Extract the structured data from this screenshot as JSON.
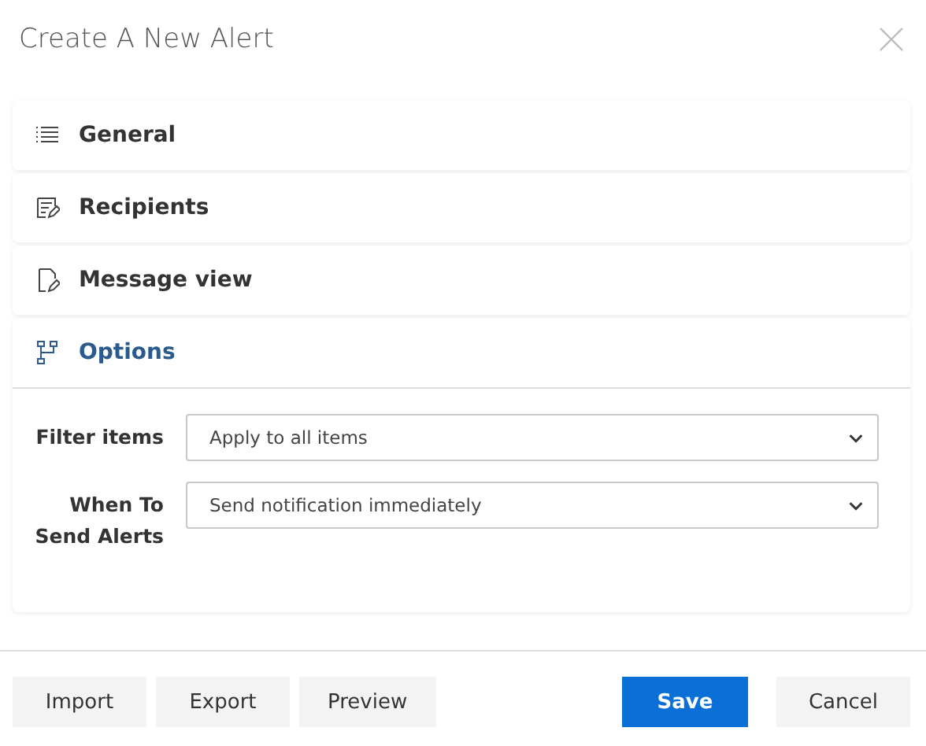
{
  "dialog": {
    "title": "Create A New Alert"
  },
  "sections": [
    {
      "label": "General",
      "kind": "list",
      "selected": false
    },
    {
      "label": "Recipients",
      "kind": "recipients",
      "selected": false
    },
    {
      "label": "Message view",
      "kind": "message",
      "selected": false
    },
    {
      "label": "Options",
      "kind": "options",
      "selected": true
    }
  ],
  "fields": [
    {
      "label": "Filter items",
      "value": "Apply to all items"
    },
    {
      "label": "When To Send Alerts",
      "value": "Send notification immediately"
    }
  ],
  "buttons": [
    {
      "label": "Import",
      "kind": "secondary"
    },
    {
      "label": "Export",
      "kind": "secondary"
    },
    {
      "label": "Preview",
      "kind": "secondary"
    },
    {
      "label": "Save",
      "kind": "primary"
    },
    {
      "label": "Cancel",
      "kind": "secondary"
    }
  ]
}
